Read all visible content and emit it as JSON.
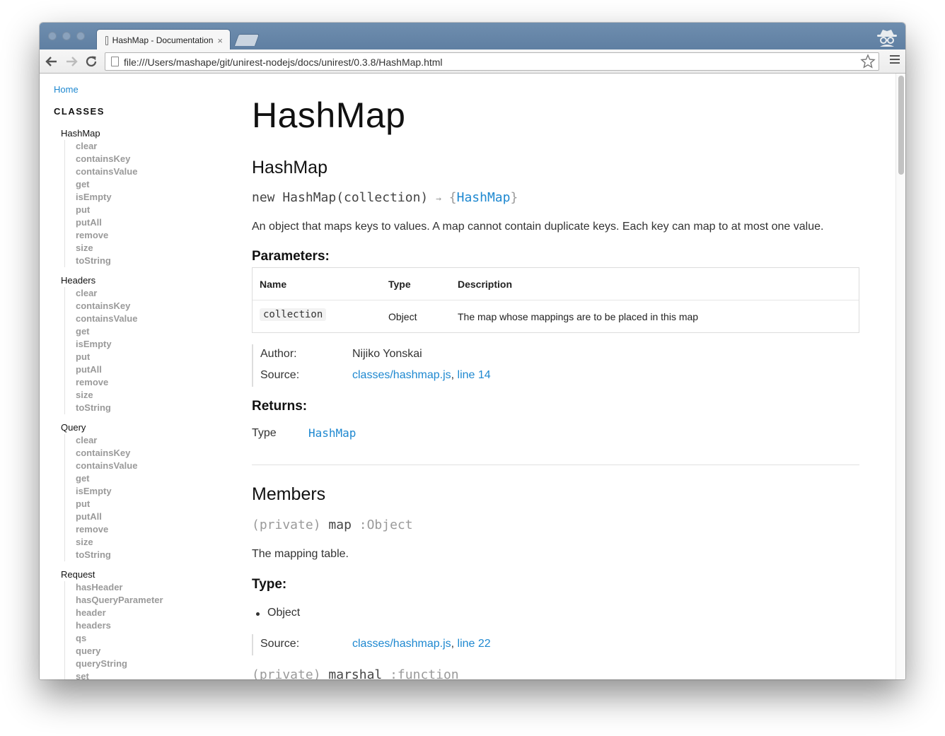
{
  "browser": {
    "tab_title": "HashMap - Documentation",
    "tab_close": "×",
    "url": "file:///Users/mashape/git/unirest-nodejs/docs/unirest/0.3.8/HashMap.html",
    "back_icon": "arrow-left-icon",
    "forward_icon": "arrow-right-icon",
    "reload_icon": "reload-icon",
    "star_icon": "star-icon",
    "menu_icon": "hamburger-menu-icon"
  },
  "sidebar": {
    "home": "Home",
    "classes_heading": "CLASSES",
    "classes": [
      {
        "name": "HashMap",
        "methods": [
          "clear",
          "containsKey",
          "containsValue",
          "get",
          "isEmpty",
          "put",
          "putAll",
          "remove",
          "size",
          "toString"
        ]
      },
      {
        "name": "Headers",
        "methods": [
          "clear",
          "containsKey",
          "containsValue",
          "get",
          "isEmpty",
          "put",
          "putAll",
          "remove",
          "size",
          "toString"
        ]
      },
      {
        "name": "Query",
        "methods": [
          "clear",
          "containsKey",
          "containsValue",
          "get",
          "isEmpty",
          "put",
          "putAll",
          "remove",
          "size",
          "toString"
        ]
      },
      {
        "name": "Request",
        "methods": [
          "hasHeader",
          "hasQueryParameter",
          "header",
          "headers",
          "qs",
          "query",
          "queryString",
          "set"
        ]
      }
    ]
  },
  "main": {
    "title": "HashMap",
    "constructor": {
      "heading": "HashMap",
      "signature_new": "new HashMap(collection)",
      "signature_arrow": "→",
      "signature_open": "{",
      "signature_type": "HashMap",
      "signature_close": "}",
      "description": "An object that maps keys to values. A map cannot contain duplicate keys. Each key can map to at most one value.",
      "parameters_heading": "Parameters:",
      "param_headers": [
        "Name",
        "Type",
        "Description"
      ],
      "params": [
        {
          "name": "collection",
          "type": "Object",
          "description": "The map whose mappings are to be placed in this map"
        }
      ],
      "author_label": "Author:",
      "author_value": "Nijiko Yonskai",
      "source_label": "Source:",
      "source_file": "classes/hashmap.js",
      "source_sep": ", ",
      "source_line": "line 14",
      "returns_heading": "Returns:",
      "returns_type_label": "Type",
      "returns_type_value": "HashMap"
    },
    "members": {
      "heading": "Members",
      "map_private": "(private)",
      "map_name": "map",
      "map_type": ":Object",
      "map_description": "The mapping table.",
      "type_heading": "Type:",
      "type_bullet": "Object",
      "source_label": "Source:",
      "source_file": "classes/hashmap.js",
      "source_sep": ", ",
      "source_line": "line 22",
      "next_private": "(private)",
      "next_name": "marshal",
      "next_type": ":function"
    }
  }
}
